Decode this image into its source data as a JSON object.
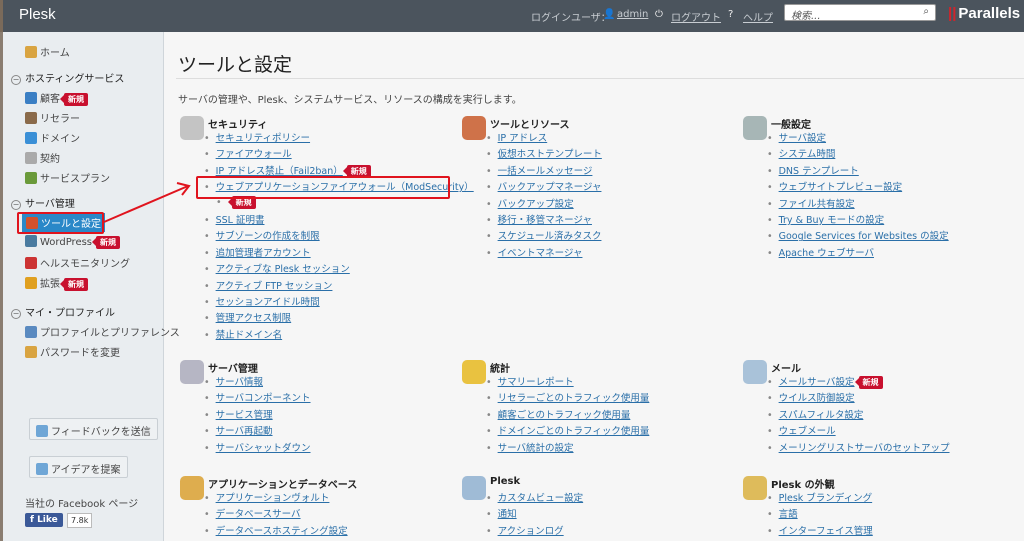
{
  "header": {
    "app": "Plesk",
    "login_label": "ログインユーザ：",
    "user": "admin",
    "logout": "ログアウト",
    "help": "ヘルプ",
    "search_placeholder": "検索...",
    "brand": "Parallels"
  },
  "badge_new": "新規",
  "sidebar": {
    "home": "ホーム",
    "groups": [
      {
        "label": "ホスティングサービス",
        "items": [
          {
            "label": "顧客",
            "icon": "user-icon",
            "new": true
          },
          {
            "label": "リセラー",
            "icon": "reseller-icon"
          },
          {
            "label": "ドメイン",
            "icon": "globe-icon"
          },
          {
            "label": "契約",
            "icon": "subscription-icon"
          },
          {
            "label": "サービスプラン",
            "icon": "service-plan-icon"
          }
        ]
      },
      {
        "label": "サーバ管理",
        "items": [
          {
            "label": "ツールと設定",
            "icon": "tools-icon",
            "active": true
          },
          {
            "label": "WordPress",
            "icon": "wordpress-icon",
            "new": true
          },
          {
            "label": "ヘルスモニタリング",
            "icon": "health-icon"
          },
          {
            "label": "拡張",
            "icon": "extensions-icon",
            "new": true
          }
        ]
      },
      {
        "label": "マイ・プロファイル",
        "items": [
          {
            "label": "プロファイルとプリファレンス",
            "icon": "profile-icon"
          },
          {
            "label": "パスワードを変更",
            "icon": "key-icon"
          }
        ]
      }
    ],
    "feedback": "フィードバックを送信",
    "idea": "アイデアを提案",
    "facebook_label": "当社の Facebook ページ",
    "like": "Like",
    "like_count": "7.8k"
  },
  "main": {
    "title": "ツールと設定",
    "description": "サーバの管理や、Plesk、システムサービス、リソースの構成を実行します。",
    "sections": [
      {
        "title": "セキュリティ",
        "icon": "shield-icon",
        "links": [
          "セキュリティポリシー",
          "ファイアウォール",
          {
            "label": "IP アドレス禁止（Fail2ban）",
            "new": true
          },
          {
            "label": "ウェブアプリケーションファイアウォール（ModSecurity）",
            "new": "below"
          },
          "SSL 証明書",
          "サブゾーンの作成を制限",
          "追加管理者アカウント",
          "アクティブな Plesk セッション",
          "アクティブ FTP セッション",
          "セッションアイドル時間",
          "管理アクセス制限",
          "禁止ドメイン名"
        ]
      },
      {
        "title": "ツールとリソース",
        "icon": "tools-icon",
        "links": [
          "IP アドレス",
          "仮想ホストテンプレート",
          "一括メールメッセージ",
          "バックアップマネージャ",
          "バックアップ設定",
          "移行・移管マネージャ",
          "スケジュール済みタスク",
          "イベントマネージャ"
        ]
      },
      {
        "title": "一般設定",
        "icon": "sliders-icon",
        "links": [
          "サーバ設定",
          "システム時間",
          "DNS テンプレート",
          "ウェブサイトプレビュー設定",
          "ファイル共有設定",
          "Try & Buy モードの設定",
          "Google Services for Websites の設定",
          "Apache ウェブサーバ"
        ]
      },
      {
        "title": "サーバ管理",
        "icon": "server-icon",
        "links": [
          "サーバ情報",
          "サーバコンポーネント",
          "サービス管理",
          "サーバ再起動",
          "サーバシャットダウン"
        ]
      },
      {
        "title": "統計",
        "icon": "chart-icon",
        "links": [
          "サマリーレポート",
          "リセラーごとのトラフィック使用量",
          "顧客ごとのトラフィック使用量",
          "ドメインごとのトラフィック使用量",
          "サーバ統計の設定"
        ]
      },
      {
        "title": "メール",
        "icon": "mail-icon",
        "links": [
          {
            "label": "メールサーバ設定",
            "new": true
          },
          "ウイルス防御設定",
          "スパムフィルタ設定",
          "ウェブメール",
          "メーリングリストサーバのセットアップ"
        ]
      },
      {
        "title": "アプリケーションとデータベース",
        "icon": "database-icon",
        "links": [
          "アプリケーションヴォルト",
          "データベースサーバ",
          "データベースホスティング設定"
        ]
      },
      {
        "title": "Plesk",
        "icon": "plesk-window-icon",
        "links": [
          "カスタムビュー設定",
          "通知",
          "アクションログ"
        ]
      },
      {
        "title": "Plesk の外観",
        "icon": "appearance-icon",
        "links": [
          "Plesk ブランディング",
          "言語",
          "インターフェイス管理"
        ]
      }
    ]
  },
  "colors": {
    "header": "#4b545d",
    "sidebar": "#e9edf0",
    "link": "#2a6fa8",
    "badge": "#c8102e",
    "active": "#2a88c8",
    "annotation": "#e0141e"
  }
}
